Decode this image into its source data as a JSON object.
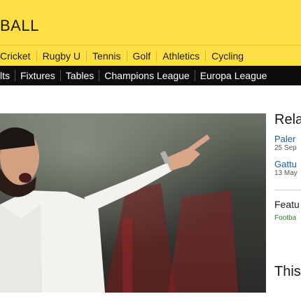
{
  "masthead": {
    "brand": "BALL"
  },
  "sports_nav": {
    "items": [
      "Cricket",
      "Rugby U",
      "Tennis",
      "Golf",
      "Athletics",
      "Cycling"
    ]
  },
  "sub_nav": {
    "items": [
      "lts",
      "Fixtures",
      "Tables",
      "Champions League",
      "Europa League"
    ],
    "cut_item": "L"
  },
  "sidebar": {
    "related_heading": "Rela",
    "related": [
      {
        "title": "Paler",
        "date": "25 Sep"
      },
      {
        "title": "Gattu",
        "date": "13 May"
      }
    ],
    "features_heading": "Featu",
    "features_tag": "Footba",
    "this_heading": "This"
  },
  "colors": {
    "accent": "#ffdf43",
    "subnav_bg": "#0d0d0d",
    "link": "#1c5e9e"
  }
}
